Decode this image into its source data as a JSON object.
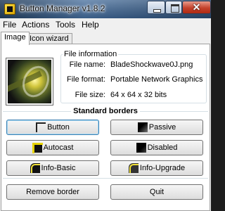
{
  "window": {
    "title": "Button Manager v1.8.2"
  },
  "menu": [
    "File",
    "Actions",
    "Tools",
    "Help"
  ],
  "tabs": [
    {
      "label": "Image",
      "active": true
    },
    {
      "label": "Icon wizard",
      "active": false
    }
  ],
  "file_info": {
    "heading": "File information",
    "name_label": "File name:",
    "name_value": "BladeShockwave0J.png",
    "format_label": "File format:",
    "format_value": "Portable Network Graphics",
    "size_label": "File size:",
    "size_value": "64 x 64 x 32 bits"
  },
  "standard_borders": {
    "heading": "Standard borders",
    "buttons": [
      {
        "label": "Button",
        "icon": "button-border-icon"
      },
      {
        "label": "Passive",
        "icon": "passive-border-icon"
      },
      {
        "label": "Autocast",
        "icon": "autocast-border-icon"
      },
      {
        "label": "Disabled",
        "icon": "disabled-border-icon"
      },
      {
        "label": "Info-Basic",
        "icon": "info-basic-border-icon"
      },
      {
        "label": "Info-Upgrade",
        "icon": "info-upgrade-border-icon"
      }
    ]
  },
  "actions": {
    "remove_border": "Remove border",
    "quit": "Quit"
  },
  "colors": {
    "titlebar": "#4f7199",
    "close_button": "#c4422c",
    "focus_border": "#3c7fb1"
  }
}
